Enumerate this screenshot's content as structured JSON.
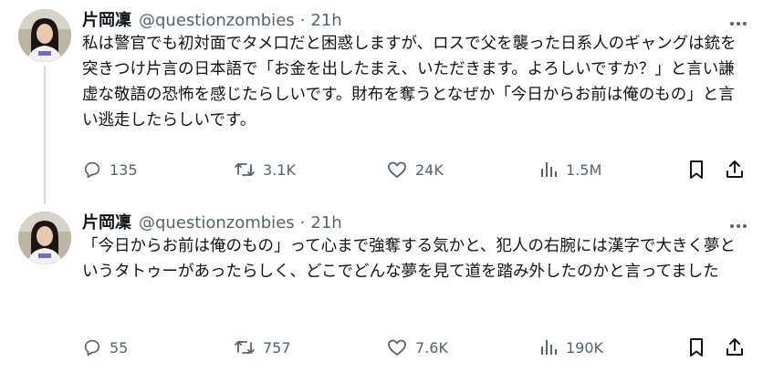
{
  "tweets": [
    {
      "author": {
        "name": "片岡凜",
        "handle": "@questionzombies",
        "separator": "·",
        "time": "21h"
      },
      "text": "私は警官でも初対面でタメ口だと困惑しますが、ロスで父を襲った日系人のギャングは銃を突きつけ片言の日本語で「お金を出したまえ、いただきます。よろしいですか？」と言い謙虚な敬語の恐怖を感じたらしいです。財布を奪うとなぜか「今日からお前は俺のもの」と言い逃走したらしいです。",
      "stats": {
        "replies": "135",
        "reposts": "3.1K",
        "likes": "24K",
        "views": "1.5M"
      }
    },
    {
      "author": {
        "name": "片岡凜",
        "handle": "@questionzombies",
        "separator": "·",
        "time": "21h"
      },
      "text": "「今日からお前は俺のもの」って心まで強奪する気かと、犯人の右腕には漢字で大きく夢というタトゥーがあったらしく、どこでどんな夢を見て道を踏み外したのかと言ってました",
      "stats": {
        "replies": "55",
        "reposts": "757",
        "likes": "7.6K",
        "views": "190K"
      }
    }
  ],
  "icons": {
    "more": "more-horizontal-icon",
    "reply": "reply-icon",
    "repost": "repost-icon",
    "like": "heart-icon",
    "views": "views-icon",
    "bookmark": "bookmark-icon",
    "share": "share-icon"
  },
  "colors": {
    "text": "#0f1419",
    "secondary": "#536471",
    "thread_line": "#cfd9de"
  }
}
